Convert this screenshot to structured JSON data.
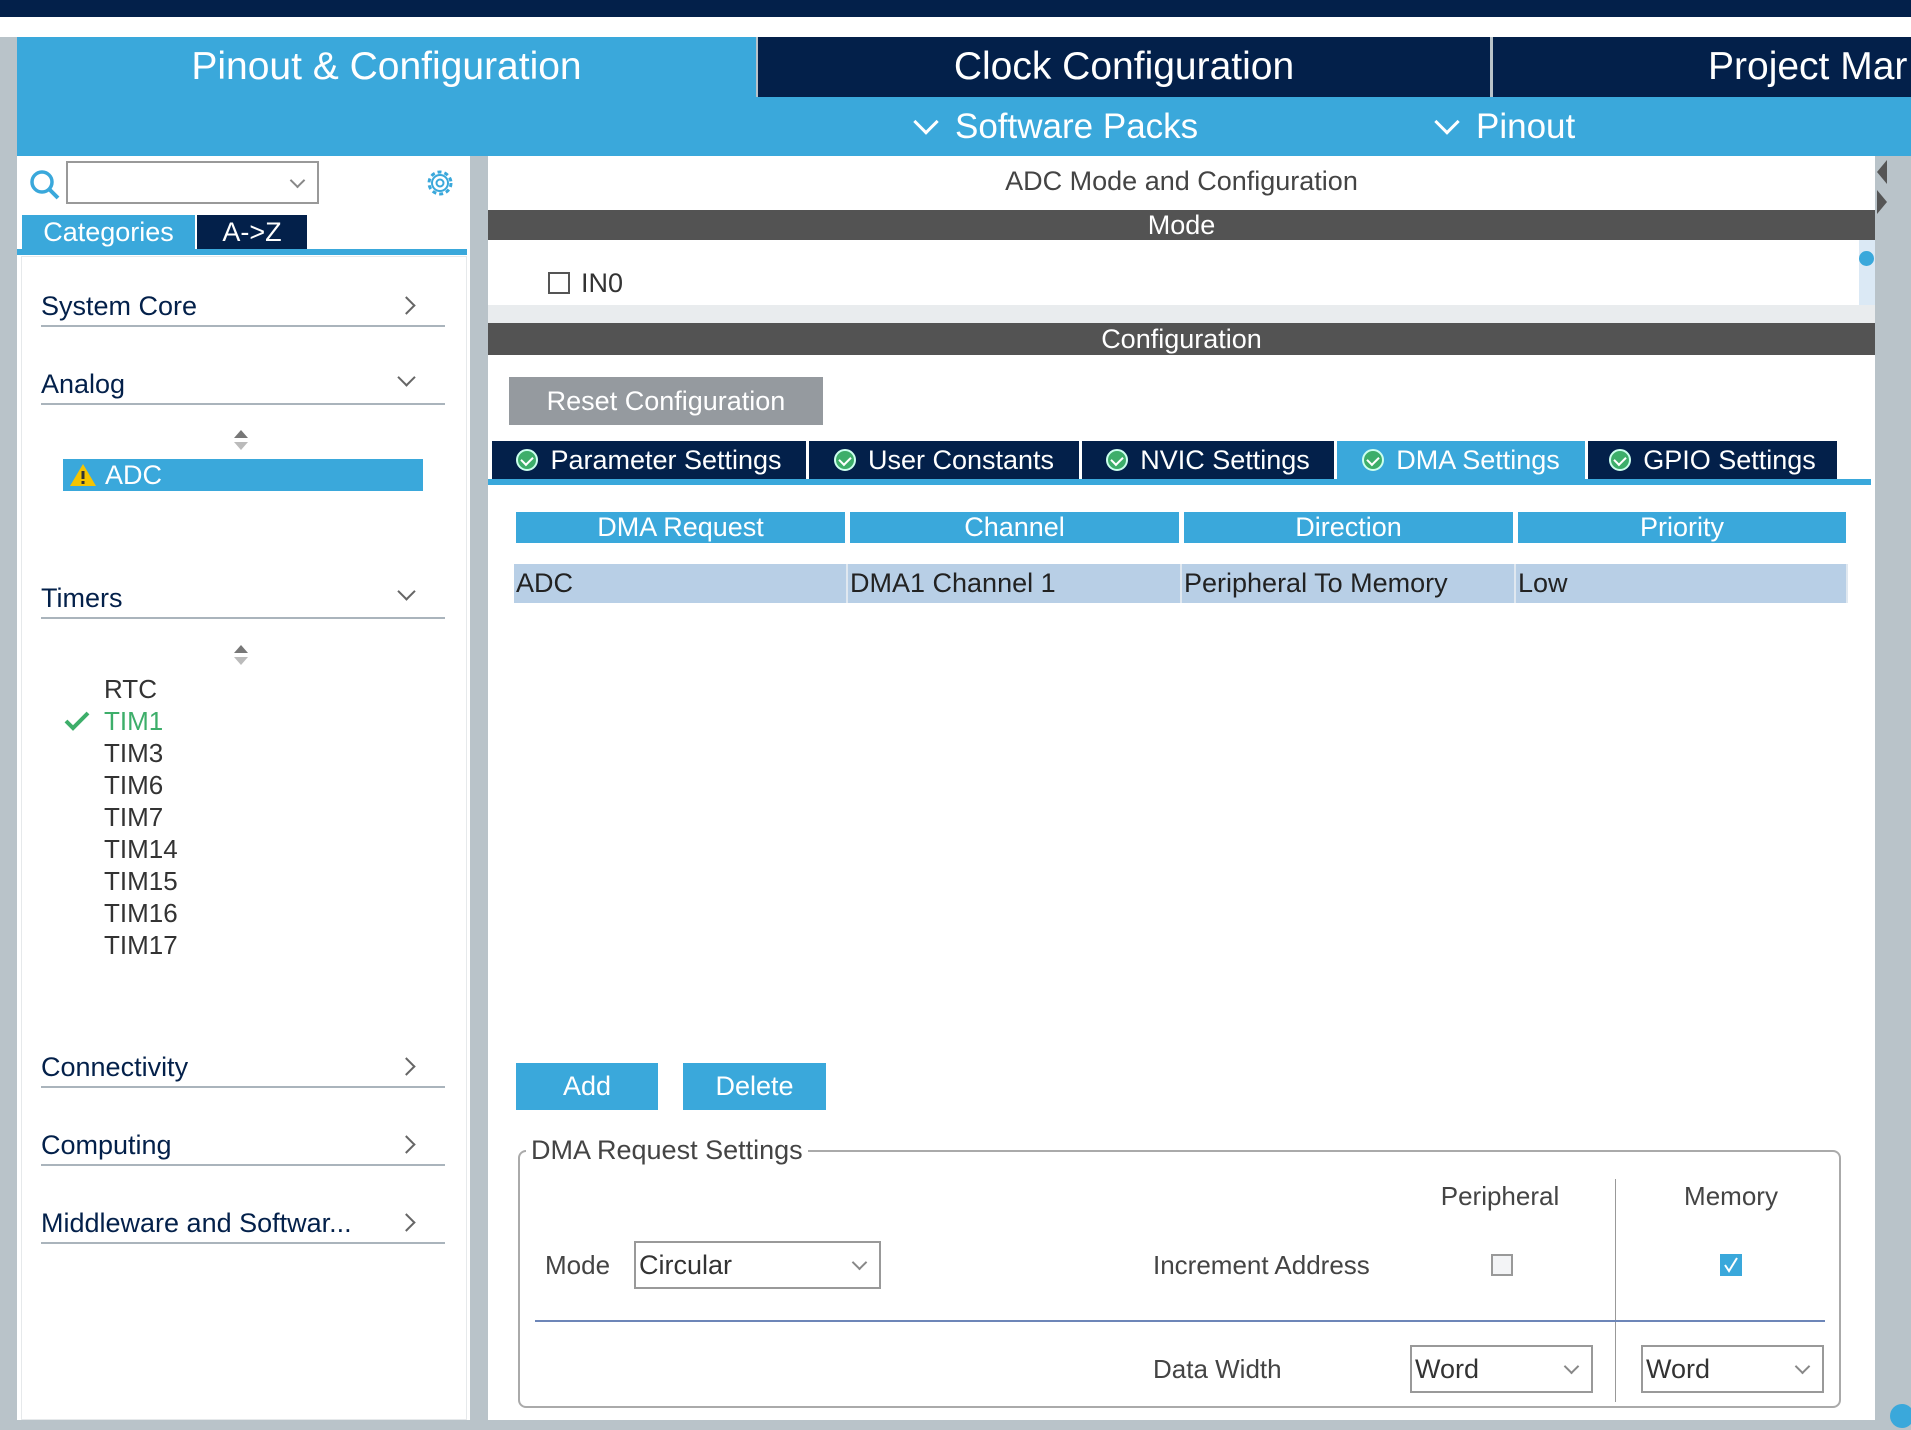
{
  "main_tabs": [
    {
      "label": "Pinout & Configuration",
      "active": true
    },
    {
      "label": "Clock Configuration"
    },
    {
      "label": "Project Mar"
    }
  ],
  "sub_menu": [
    {
      "label": "Software Packs"
    },
    {
      "label": "Pinout"
    }
  ],
  "sidebar": {
    "search_value": "",
    "view_tabs": [
      {
        "label": "Categories",
        "active": true
      },
      {
        "label": "A->Z"
      }
    ],
    "categories": [
      {
        "label": "System Core",
        "expanded": false
      },
      {
        "label": "Analog",
        "expanded": true,
        "items": [
          {
            "label": "ADC",
            "selected": true,
            "status": "warning"
          }
        ]
      },
      {
        "label": "Timers",
        "expanded": true,
        "items": [
          {
            "label": "RTC"
          },
          {
            "label": "TIM1",
            "status": "ok"
          },
          {
            "label": "TIM3"
          },
          {
            "label": "TIM6"
          },
          {
            "label": "TIM7"
          },
          {
            "label": "TIM14"
          },
          {
            "label": "TIM15"
          },
          {
            "label": "TIM16"
          },
          {
            "label": "TIM17"
          }
        ]
      },
      {
        "label": "Connectivity",
        "expanded": false
      },
      {
        "label": "Computing",
        "expanded": false
      },
      {
        "label": "Middleware and Softwar...",
        "expanded": false
      }
    ]
  },
  "content": {
    "title": "ADC Mode and Configuration",
    "mode_header": "Mode",
    "mode_options": [
      {
        "label": "IN0",
        "checked": false
      }
    ],
    "config_header": "Configuration",
    "reset_label": "Reset Configuration",
    "config_tabs": [
      {
        "label": "Parameter Settings"
      },
      {
        "label": "User Constants"
      },
      {
        "label": "NVIC Settings"
      },
      {
        "label": "DMA Settings",
        "active": true
      },
      {
        "label": "GPIO Settings"
      }
    ],
    "dma_table": {
      "columns": [
        "DMA Request",
        "Channel",
        "Direction",
        "Priority"
      ],
      "rows": [
        [
          "ADC",
          "DMA1 Channel 1",
          "Peripheral To Memory",
          "Low"
        ]
      ]
    },
    "add_label": "Add",
    "delete_label": "Delete",
    "request_settings": {
      "legend": "DMA Request Settings",
      "peripheral_header": "Peripheral",
      "memory_header": "Memory",
      "mode_label": "Mode",
      "mode_value": "Circular",
      "increment_label": "Increment Address",
      "increment_peripheral": false,
      "increment_memory": true,
      "data_width_label": "Data Width",
      "peripheral_width": "Word",
      "memory_width": "Word"
    }
  },
  "colors": {
    "accent": "#3aa8db",
    "navy": "#03204a",
    "header_gray": "#535353",
    "row_selected": "#b8cfe6",
    "ok": "#3dae6a",
    "warning": "#f5c400"
  }
}
